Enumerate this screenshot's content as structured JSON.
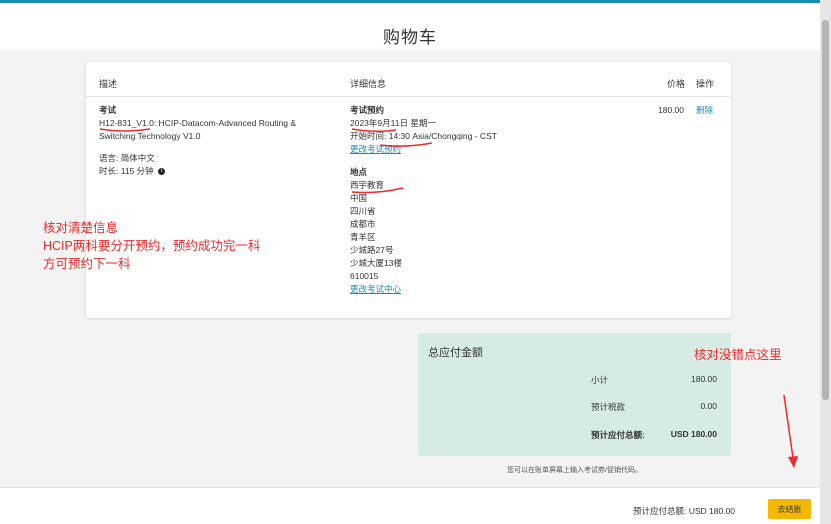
{
  "page": {
    "title": "购物车"
  },
  "table": {
    "headers": {
      "description": "描述",
      "details": "详细信息",
      "price": "价格",
      "action": "操作"
    }
  },
  "item": {
    "type_label": "考试",
    "exam_code": "H12-831_V1.0",
    "exam_name": ": HCIP-Datacom-Advanced Routing &",
    "exam_name_line2": "Switching Technology V1.0",
    "language": "语言: 简体中文",
    "duration": "时长: 115 分钟",
    "appointment_label": "考试预约",
    "appointment_date": "2023年9月11日 星期一",
    "start_time": "开始时间: 14:30 Asia/Chongqing - CST",
    "change_appointment": "更改考试预约",
    "location_label": "地点",
    "location_lines": [
      "西宇教育",
      "中国",
      "四川省",
      "成都市",
      "青羊区",
      "少城路27号",
      "少城大厦13楼",
      "610015"
    ],
    "change_center": "更改考试中心",
    "price": "180.00",
    "delete": "删除"
  },
  "annotations": {
    "left": [
      "核对清楚信息",
      "HCIP两科要分开预约，预约成功完一科",
      "方可预约下一科"
    ],
    "right": "核对没错点这里"
  },
  "summary": {
    "title": "总应付金额",
    "subtotal_label": "小计",
    "subtotal_value": "180.00",
    "tax_label": "预计税款",
    "tax_value": "0.00",
    "total_label": "预计应付总额:",
    "total_value": "USD 180.00"
  },
  "note": "您可以在账单屏幕上输入考试券/促销代码。",
  "footer": {
    "total_text": "预计应付总额:  USD 180.00",
    "checkout_label": "去结账"
  },
  "colors": {
    "accent": "#1a8bb3",
    "button": "#f5b800",
    "summary_bg": "#d5ebe4",
    "annotation": "#ee2a2a"
  }
}
